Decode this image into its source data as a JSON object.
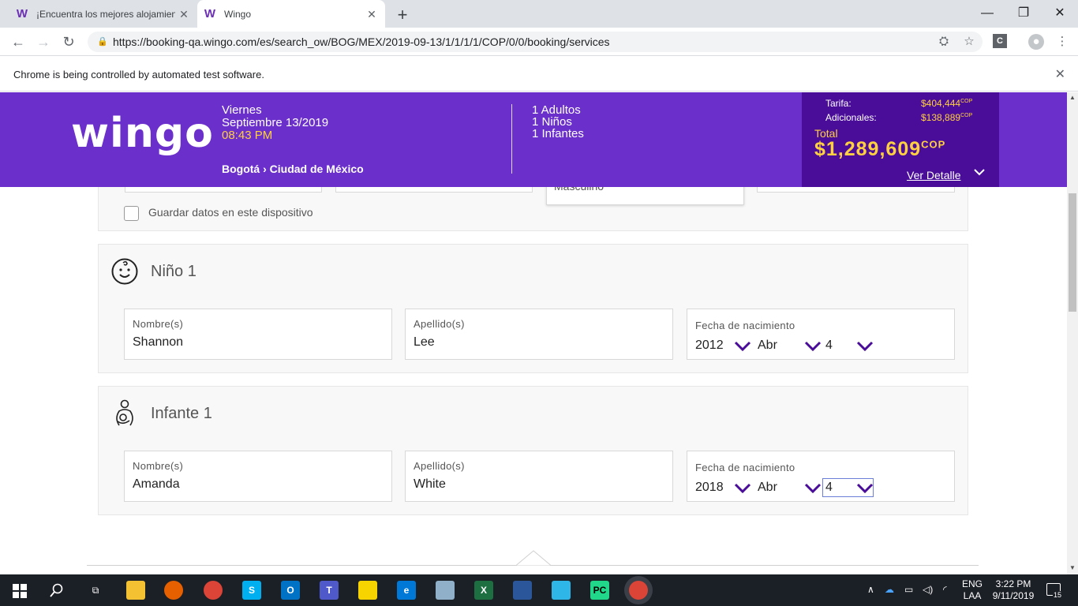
{
  "browser": {
    "tabs": [
      {
        "icon": "W",
        "title": "¡Encuentra los mejores alojamien"
      },
      {
        "icon": "W",
        "title": "Wingo"
      }
    ],
    "new_tab": "+",
    "url": "https://booking-qa.wingo.com/es/search_ow/BOG/MEX/2019-09-13/1/1/1/1/COP/0/0/booking/services",
    "infobar": "Chrome is being controlled by automated test software.",
    "profile_initial": "C"
  },
  "header": {
    "logo": "wingo",
    "day": "Viernes",
    "date": "Septiembre 13/2019",
    "time": "08:43 PM",
    "route": "Bogotá › Ciudad de México",
    "passengers": [
      "1 Adultos",
      "1 Niños",
      "1 Infantes"
    ],
    "price": {
      "tarifa_label": "Tarifa:",
      "tarifa_value": "$404,444",
      "adicionales_label": "Adicionales:",
      "adicionales_value": "$138,889",
      "currency": "COP",
      "total_label": "Total",
      "total_value": "$1,289,609",
      "detail_link": "Ver Detalle"
    }
  },
  "form": {
    "partial_field_text": "Masculino",
    "save_checkbox_label": "Guardar datos en este dispositivo",
    "child": {
      "title": "Niño 1",
      "first_name_label": "Nombre(s)",
      "first_name": "Shannon",
      "last_name_label": "Apellido(s)",
      "last_name": "Lee",
      "dob_label": "Fecha de nacimiento",
      "dob_year": "2012",
      "dob_month": "Abr",
      "dob_day": "4"
    },
    "infant": {
      "title": "Infante 1",
      "first_name_label": "Nombre(s)",
      "first_name": "Amanda",
      "last_name_label": "Apellido(s)",
      "last_name": "White",
      "dob_label": "Fecha de nacimiento",
      "dob_year": "2018",
      "dob_month": "Abr",
      "dob_day": "4"
    }
  },
  "taskbar": {
    "lang_1": "ENG",
    "lang_2": "LAA",
    "time": "3:22 PM",
    "date": "9/11/2019",
    "notifications": "15"
  }
}
